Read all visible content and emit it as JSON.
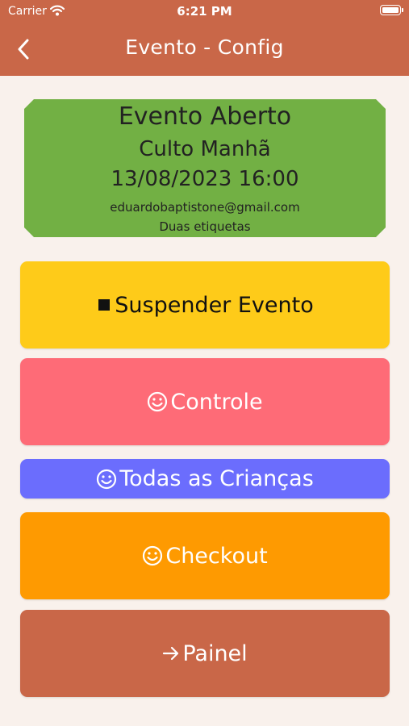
{
  "status_bar": {
    "carrier": "Carrier",
    "time": "6:21 PM"
  },
  "app_bar": {
    "title": "Evento - Config"
  },
  "event": {
    "status": "Evento Aberto",
    "name": "Culto Manhã",
    "datetime": "13/08/2023 16:00",
    "email": "eduardobaptistone@gmail.com",
    "labels": "Duas etiquetas"
  },
  "buttons": {
    "suspend": "Suspender Evento",
    "controle": "Controle",
    "todas": "Todas as Crianças",
    "checkout": "Checkout",
    "painel": "Painel"
  },
  "icons": {
    "back": "chevron-left-icon",
    "suspend": "stop-icon",
    "controle": "smiley-icon",
    "todas": "smiley-icon",
    "checkout": "smiley-icon",
    "painel": "arrow-right-icon"
  },
  "colors": {
    "app_bar": "#c96748",
    "background": "#f9f1ec",
    "event_card": "#72b044",
    "suspend": "#fecb19",
    "controle": "#fe6b77",
    "todas": "#6b6dfd",
    "checkout": "#fe9a01",
    "painel": "#c96748"
  }
}
